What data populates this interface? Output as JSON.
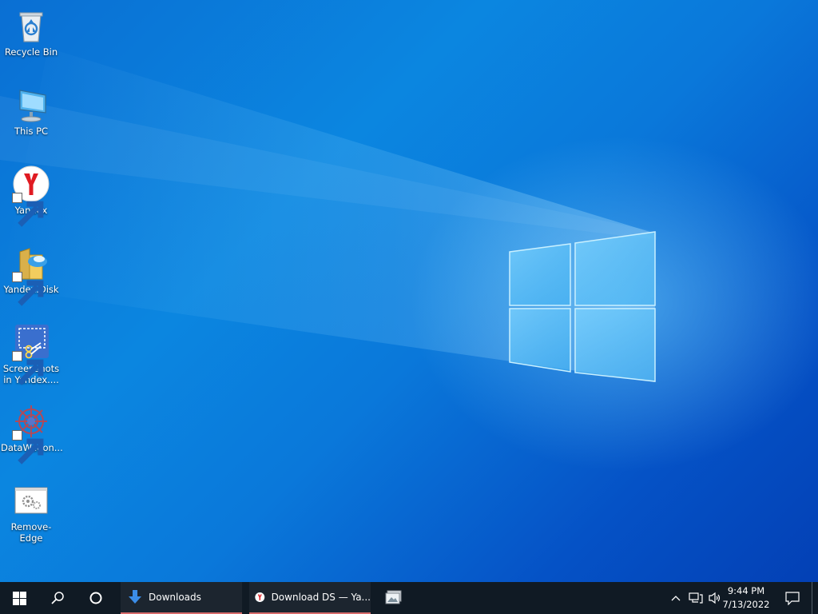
{
  "desktop_icons": [
    {
      "label": "Recycle Bin",
      "icon": "recycle-bin-icon"
    },
    {
      "label": "This PC",
      "icon": "computer-icon"
    },
    {
      "label": "Yandex",
      "icon": "yandex-browser-icon"
    },
    {
      "label": "Yandex.Disk",
      "icon": "yandex-disk-icon"
    },
    {
      "label": "Screenshots in Yandex....",
      "icon": "screenshots-icon"
    },
    {
      "label": "DataWagon...",
      "icon": "datawagon-icon"
    },
    {
      "label": "Remove-Edge",
      "icon": "settings-window-icon"
    }
  ],
  "taskbar": {
    "apps": [
      {
        "label": "Downloads",
        "icon": "download-arrow-icon"
      },
      {
        "label": "Download DS — Ya...",
        "icon": "yandex-browser-icon"
      }
    ],
    "tray": {
      "time": "9:44 PM",
      "date": "7/13/2022"
    }
  },
  "colors": {
    "taskbar_bg": "#101a24",
    "wallpaper_blue": "#0a78da",
    "active_underline": "#d86b6b"
  }
}
